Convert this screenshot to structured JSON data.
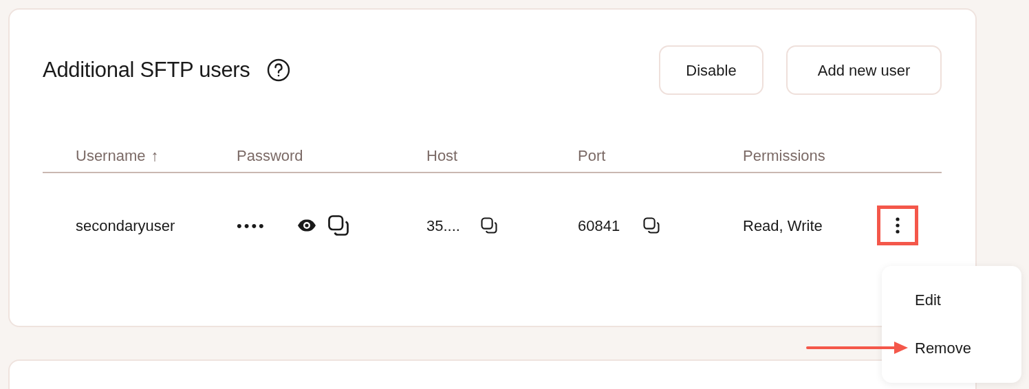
{
  "section": {
    "title": "Additional SFTP users",
    "buttons": [
      "Disable",
      "Add new user"
    ]
  },
  "table": {
    "columns": [
      {
        "label": "Username",
        "sort": "↑"
      },
      {
        "label": "Password"
      },
      {
        "label": "Host"
      },
      {
        "label": "Port"
      },
      {
        "label": "Permissions"
      }
    ],
    "rows": [
      {
        "username": "secondaryuser",
        "password": "••••",
        "host": "35....",
        "port": "60841",
        "permissions": "Read, Write",
        "actions_highlighted": true
      }
    ]
  },
  "menu": {
    "items": [
      {
        "label": "Edit",
        "pointed": false
      },
      {
        "label": "Remove",
        "pointed": true
      }
    ]
  }
}
